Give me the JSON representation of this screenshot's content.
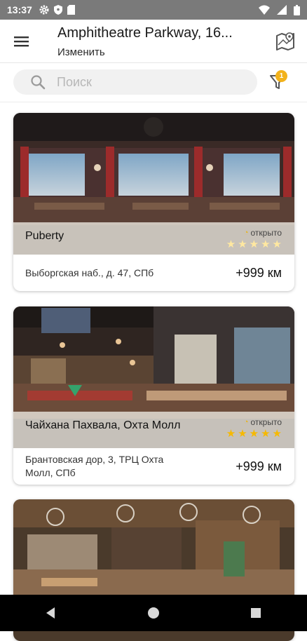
{
  "status_bar": {
    "time": "13:37",
    "icons": [
      "gear-icon",
      "shield-icon",
      "sd-card-icon",
      "wifi-icon",
      "signal-icon",
      "battery-icon"
    ]
  },
  "header": {
    "address": "Amphitheatre Parkway, 16...",
    "change_label": "Изменить",
    "icons": [
      "menu-icon",
      "map-icon"
    ]
  },
  "search": {
    "placeholder": "Поиск",
    "filter_badge": "1",
    "icons": [
      "search-icon",
      "filter-icon"
    ]
  },
  "colors": {
    "accent": "#f2b21b",
    "star": "#f6b900",
    "overlay": "#e8e4dc",
    "navbar": "#000000",
    "status_bar": "#7a7a7a"
  },
  "restaurants": [
    {
      "name": "Puberty",
      "status": "открыто",
      "rating": 0,
      "address": "Выборгская наб., д. 47,  СПб",
      "distance": "+999 км"
    },
    {
      "name": "Чайхана Пахвала, Охта Молл",
      "status": "открыто",
      "rating": 5,
      "address": "Брантовская дор, 3, ТРЦ Охта Молл,  СПб",
      "distance": "+999 км"
    },
    {
      "name": "",
      "status": "",
      "rating": null,
      "address": "",
      "distance": ""
    }
  ],
  "navigation": {
    "icons": [
      "back-icon",
      "home-icon",
      "recents-icon"
    ]
  }
}
